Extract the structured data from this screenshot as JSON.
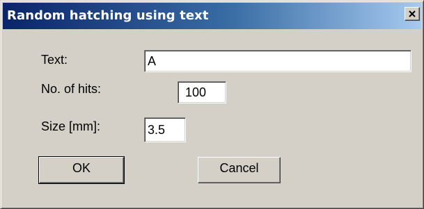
{
  "window": {
    "title": "Random hatching using text"
  },
  "form": {
    "text_label": "Text:",
    "text_value": "A",
    "hits_label": "No. of hits:",
    "hits_value": "100",
    "size_label": "Size [mm]:",
    "size_value": "3.5"
  },
  "buttons": {
    "ok_label": "OK",
    "cancel_label": "Cancel"
  },
  "icons": {
    "close": "close-icon"
  }
}
